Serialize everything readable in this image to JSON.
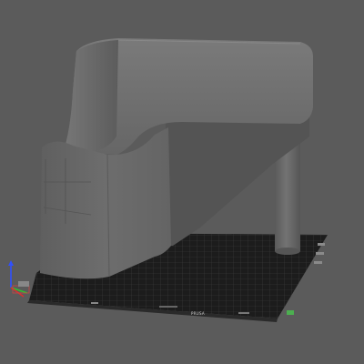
{
  "viewport": {
    "background": "#5b5b5b",
    "bed_color": "#1b1b1b",
    "grid_color": "#3a3a3a",
    "model_color": "#6e6e6e"
  },
  "bed": {
    "front_label": "PRUSA"
  },
  "axes": {
    "x_color": "#d83030",
    "y_color": "#30c030",
    "z_color": "#3050ff"
  },
  "widgets": {
    "corner_marker": "",
    "right_marker": ""
  }
}
